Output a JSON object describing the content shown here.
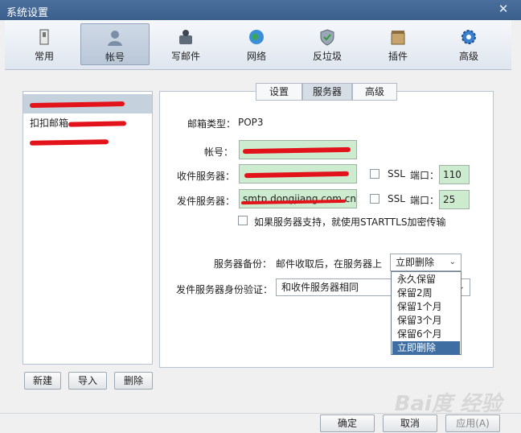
{
  "window": {
    "title": "系统设置",
    "close_glyph": "✕"
  },
  "toolbar": {
    "items": [
      {
        "label": "常用",
        "icon": "general-icon"
      },
      {
        "label": "帐号",
        "icon": "account-icon"
      },
      {
        "label": "写邮件",
        "icon": "compose-icon"
      },
      {
        "label": "网络",
        "icon": "globe-icon"
      },
      {
        "label": "反垃圾",
        "icon": "shield-icon"
      },
      {
        "label": "插件",
        "icon": "plugin-icon"
      },
      {
        "label": "高级",
        "icon": "gear-icon"
      }
    ],
    "selected": "帐号"
  },
  "accounts": {
    "items": [
      "扣扣邮箱"
    ],
    "buttons": {
      "new": "新建",
      "import": "导入",
      "delete": "删除"
    }
  },
  "tabs": {
    "items": [
      "设置",
      "服务器",
      "高级"
    ],
    "selected": "服务器"
  },
  "form": {
    "mailbox_type_label": "邮箱类型：",
    "mailbox_type_value": "POP3",
    "account_label": "帐号：",
    "incoming_label": "收件服务器：",
    "outgoing_label": "发件服务器：",
    "outgoing_value": "smtp.dongjiang.com.cn",
    "ssl_label": "SSL",
    "port_label": "端口：",
    "incoming_port": "110",
    "outgoing_port": "25",
    "starttls_label": "如果服务器支持，就使用STARTTLS加密传输",
    "backup_label": "服务器备份：",
    "backup_desc": "邮件收取后，在服务器上",
    "backup_value": "立即删除",
    "auth_label": "发件服务器身份验证：",
    "auth_value": "和收件服务器相同"
  },
  "dropdown": {
    "options": [
      "永久保留",
      "保留2周",
      "保留1个月",
      "保留3个月",
      "保留6个月",
      "立即删除"
    ],
    "selected": "立即删除"
  },
  "footer": {
    "ok": "确定",
    "cancel": "取消",
    "apply": "应用(A)"
  },
  "watermark": "Bai度 经验",
  "colors": {
    "title_bar": "#3b5f8c",
    "input_bg": "#cdeccf",
    "selected_item": "#3f6ea3",
    "redaction": "#e3131b"
  }
}
